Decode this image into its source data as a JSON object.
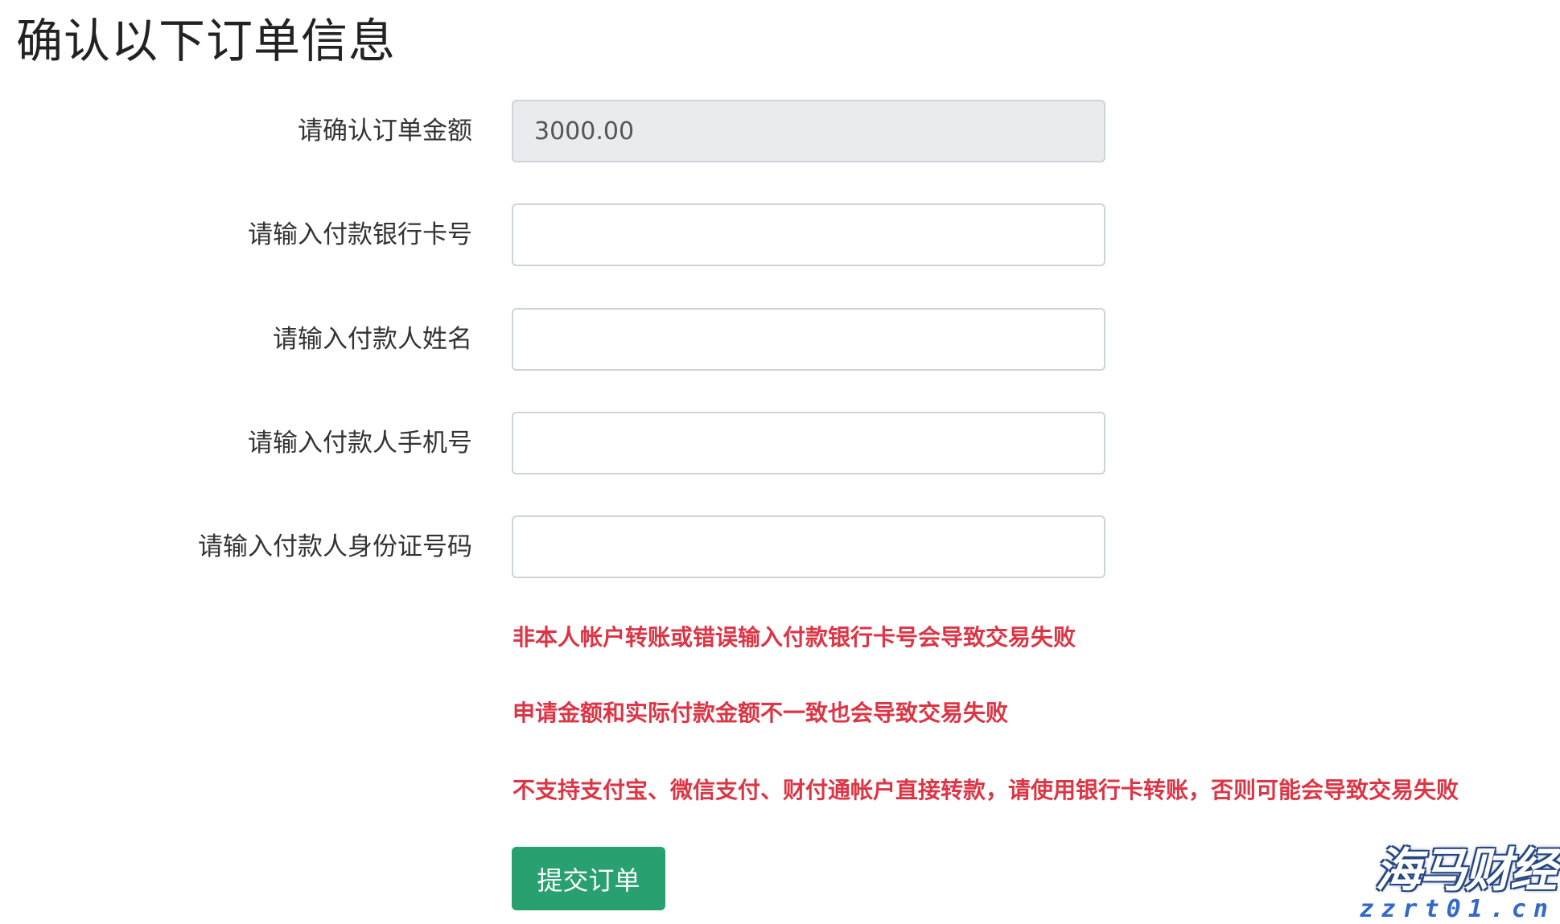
{
  "page": {
    "title": "确认以下订单信息"
  },
  "form": {
    "amount": {
      "label": "请确认订单金额",
      "value": "3000.00"
    },
    "bank_card": {
      "label": "请输入付款银行卡号",
      "value": ""
    },
    "payer_name": {
      "label": "请输入付款人姓名",
      "value": ""
    },
    "payer_phone": {
      "label": "请输入付款人手机号",
      "value": ""
    },
    "payer_id": {
      "label": "请输入付款人身份证号码",
      "value": ""
    }
  },
  "warnings": [
    "非本人帐户转账或错误输入付款银行卡号会导致交易失败",
    "申请金额和实际付款金额不一致也会导致交易失败",
    "不支持支付宝、微信支付、财付通帐户直接转款，请使用银行卡转账，否则可能会导致交易失败"
  ],
  "submit": {
    "label": "提交订单"
  },
  "watermark": {
    "brand": "海马财经",
    "domain": "zzrt01.cn"
  },
  "colors": {
    "warning": "#dc3545",
    "submit_button": "#28a070",
    "readonly_input": "#e9ecef",
    "watermark_text": "#2a62c8"
  }
}
